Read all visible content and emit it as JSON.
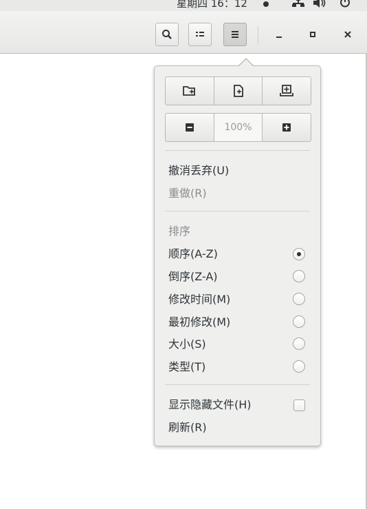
{
  "topbar": {
    "clock": "星期四 16：12"
  },
  "headerbar": {
    "buttons": [
      "search",
      "view-list",
      "menu"
    ]
  },
  "popover": {
    "new_actions": [
      "new-folder",
      "new-document",
      "new-tab"
    ],
    "zoom": {
      "value": "100%"
    },
    "undo_label": "撤消丢弃(U)",
    "redo_label": "重做(R)",
    "sort_header": "排序",
    "sort_options": [
      {
        "label": "顺序(A-Z)",
        "selected": true
      },
      {
        "label": "倒序(Z-A)",
        "selected": false
      },
      {
        "label": "修改时间(M)",
        "selected": false
      },
      {
        "label": "最初修改(M)",
        "selected": false
      },
      {
        "label": "大小(S)",
        "selected": false
      },
      {
        "label": "类型(T)",
        "selected": false
      }
    ],
    "show_hidden_label": "显示隐藏文件(H)",
    "show_hidden_checked": false,
    "refresh_label": "刷新(R)"
  }
}
